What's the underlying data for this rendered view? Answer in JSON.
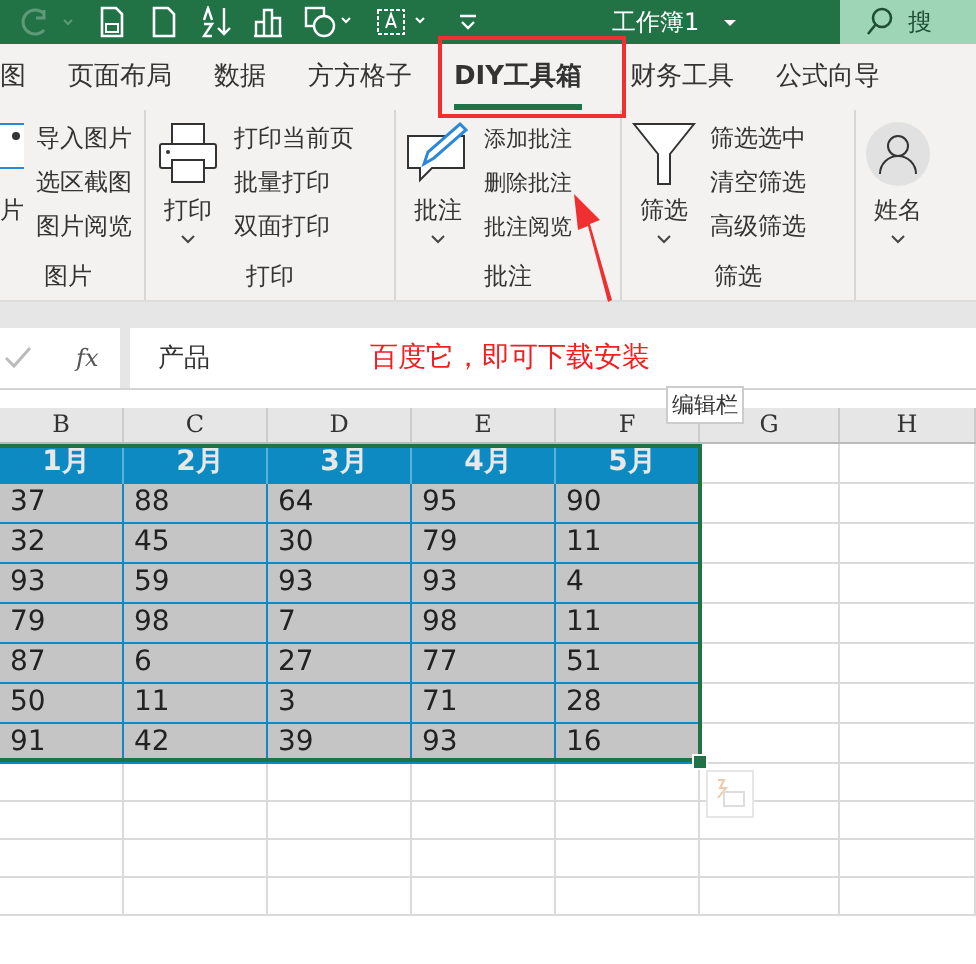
{
  "title_bar": {
    "title": "工作簿1",
    "search_placeholder": "搜"
  },
  "tabs": [
    {
      "label": "图",
      "selected": false
    },
    {
      "label": "页面布局",
      "selected": false
    },
    {
      "label": "数据",
      "selected": false
    },
    {
      "label": "方方格子",
      "selected": false
    },
    {
      "label": "DIY工具箱",
      "selected": true
    },
    {
      "label": "财务工具",
      "selected": false
    },
    {
      "label": "公式向导",
      "selected": false
    }
  ],
  "ribbon_groups": [
    {
      "label": "图片",
      "big": "片",
      "kind": "picture",
      "caret": false,
      "items": [
        "导入图片",
        "选区截图",
        "图片阅览"
      ]
    },
    {
      "label": "打印",
      "big": "打印",
      "kind": "printer",
      "caret": true,
      "items": [
        "打印当前页",
        "批量打印",
        "双面打印"
      ]
    },
    {
      "label": "批注",
      "big": "批注",
      "kind": "comment",
      "caret": true,
      "items": [
        "添加批注",
        "删除批注",
        "批注阅览"
      ]
    },
    {
      "label": "筛选",
      "big": "筛选",
      "kind": "filter",
      "caret": true,
      "items": [
        "筛选选中",
        "清空筛选",
        "高级筛选"
      ]
    },
    {
      "big": "姓名",
      "kind": "person",
      "caret": true
    }
  ],
  "formula_bar": {
    "fx": "fx",
    "value": "产品",
    "annotation": "百度它，即可下载安装",
    "tooltip": "编辑栏"
  },
  "sheet": {
    "columns": [
      "B",
      "C",
      "D",
      "E",
      "F",
      "G",
      "H"
    ],
    "header": [
      "1月",
      "2月",
      "3月",
      "4月",
      "5月"
    ],
    "rows": [
      [
        "37",
        "88",
        "64",
        "95",
        "90"
      ],
      [
        "32",
        "45",
        "30",
        "79",
        "11"
      ],
      [
        "93",
        "59",
        "93",
        "93",
        "4"
      ],
      [
        "79",
        "98",
        "7",
        "98",
        "11"
      ],
      [
        "87",
        "6",
        "27",
        "77",
        "51"
      ],
      [
        "50",
        "11",
        "3",
        "71",
        "28"
      ],
      [
        "91",
        "42",
        "39",
        "93",
        "16"
      ]
    ]
  }
}
